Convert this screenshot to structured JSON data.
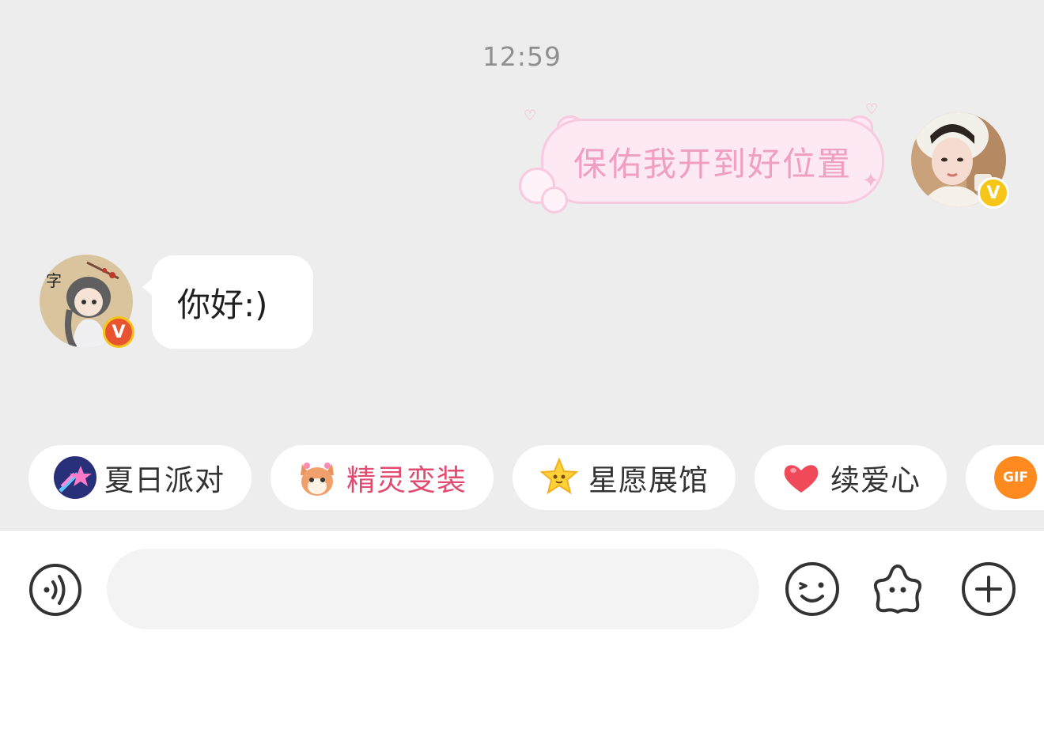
{
  "chat": {
    "timestamp": "12:59",
    "messages": [
      {
        "direction": "outgoing",
        "text": "保佑我开到好位置",
        "bubble_style": "pink-bear",
        "avatar": "user-avatar-selfie",
        "badge": "V",
        "badge_color": "#f5c518"
      },
      {
        "direction": "incoming",
        "text": "你好:)",
        "avatar": "contact-avatar-illustration",
        "badge": "V",
        "badge_color": "#e8542f"
      }
    ]
  },
  "chips": [
    {
      "label": "夏日派对",
      "icon": "shooting-star-icon",
      "color": "#333333"
    },
    {
      "label": "精灵变装",
      "icon": "fox-spirit-icon",
      "color": "#e24a6f"
    },
    {
      "label": "星愿展馆",
      "icon": "star-face-icon",
      "color": "#333333"
    },
    {
      "label": "续爱心",
      "icon": "heart-icon",
      "color": "#333333"
    },
    {
      "label": "GIF",
      "icon": "gif-icon",
      "color": "#ff7a1a"
    }
  ],
  "input": {
    "value": "",
    "placeholder": "",
    "voice_icon": "voice-icon",
    "tools": [
      "emoji-icon",
      "sticker-icon",
      "plus-icon"
    ]
  },
  "colors": {
    "chat_bg": "#ededed",
    "outgoing_bubble": "#fde9f3",
    "outgoing_text": "#f09ec1",
    "accent_red": "#e24a6f"
  }
}
